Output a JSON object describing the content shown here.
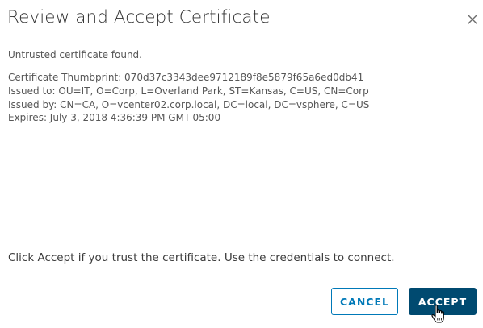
{
  "dialog": {
    "title": "Review and Accept Certificate",
    "message": "Untrusted certificate found.",
    "certificate": {
      "thumbprint": "Certificate Thumbprint: 070d37c3343dee9712189f8e5879f65a6ed0db41",
      "issued_to": "Issued to: OU=IT, O=Corp, L=Overland Park, ST=Kansas, C=US, CN=Corp",
      "issued_by": "Issued by: CN=CA, O=vcenter02.corp.local, DC=local, DC=vsphere, C=US",
      "expires": "Expires: July 3, 2018 4:36:39 PM GMT-05:00"
    },
    "footer_text": "Click Accept if you trust the certificate. Use the credentials to connect.",
    "buttons": {
      "cancel": "CANCEL",
      "accept": "ACCEPT"
    }
  },
  "icons": {
    "close": "close-icon",
    "cursor": "hand-pointer-icon"
  },
  "colors": {
    "primary": "#004a70",
    "outline": "#0079b8",
    "title": "#313131",
    "text": "#565656"
  }
}
